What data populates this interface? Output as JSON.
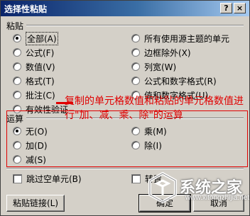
{
  "dialog": {
    "title": "选择性粘贴",
    "help_label": "?",
    "close_label": "×"
  },
  "paste": {
    "label": "粘贴",
    "left": [
      "全部(A)",
      "公式(F)",
      "数值(V)",
      "格式(T)",
      "批注(C)",
      "有效性验证"
    ],
    "right": [
      "所有使用源主题的单元",
      "边框除外(X)",
      "列宽(W)",
      "公式和数字格式(R)",
      "值和数字格式(U)"
    ],
    "selected": "全部(A)"
  },
  "operation": {
    "label": "运算",
    "left": [
      "无(O)",
      "加(D)",
      "减(S)"
    ],
    "right": [
      "乘(M)",
      "除(I)"
    ],
    "selected": "无(O)"
  },
  "checkboxes": {
    "skip_blanks": "跳过空单元(B)",
    "transpose": "转置"
  },
  "buttons": {
    "paste_link": "粘贴链接(L)",
    "ok": "确定",
    "cancel": "取消"
  },
  "annotation": {
    "text": "复制的单元格数值和粘贴的单元格数值进行\"加、减、乘、除\"的运算",
    "color": "#e00000"
  },
  "watermark": {
    "text": "系统之家",
    "url": "www.xitongzhijia.net"
  }
}
